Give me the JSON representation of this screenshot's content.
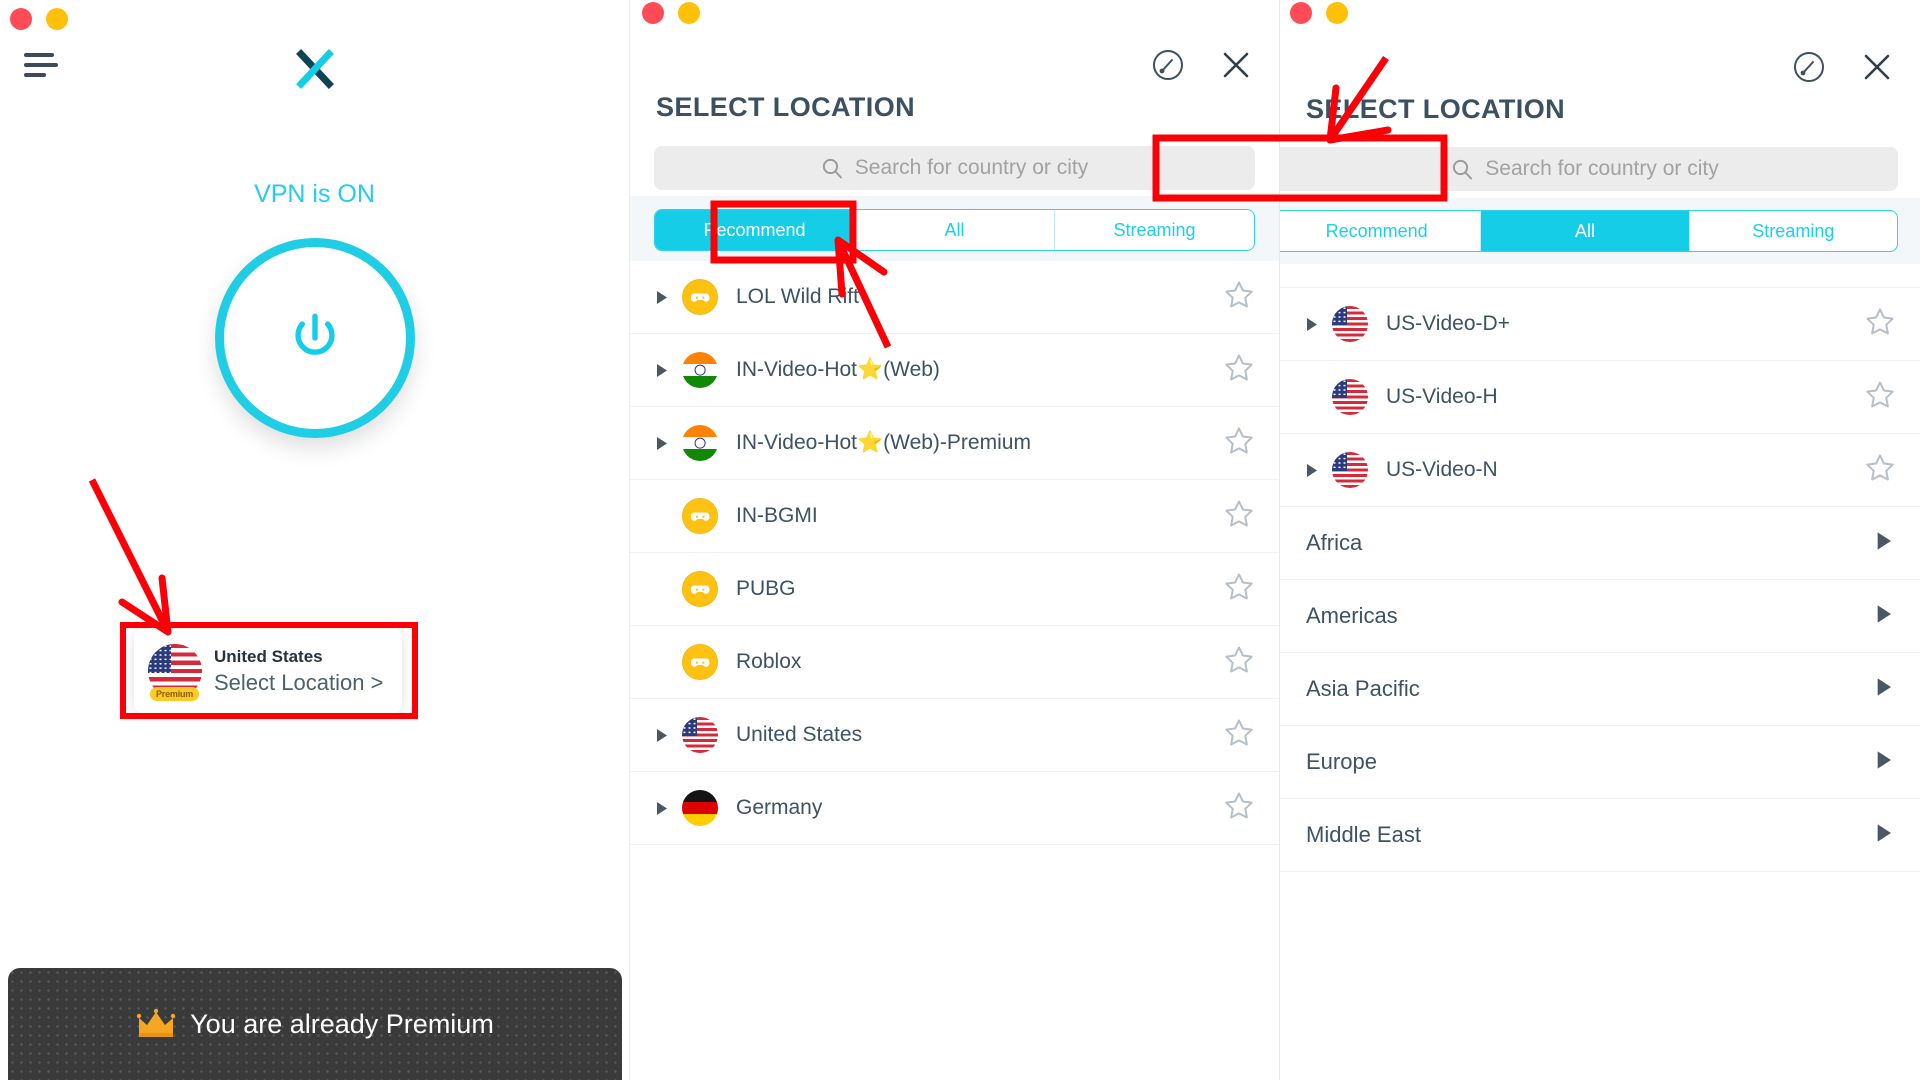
{
  "app": {
    "brand_logo": "x-logo",
    "menu_icon": "hamburger-icon"
  },
  "main_panel": {
    "vpn_status": "VPN is ON",
    "power_button_icon": "power-icon",
    "location_card": {
      "country": "United States",
      "flag": "us-flag",
      "badge": "Premium",
      "action": "Select Location >"
    },
    "premium_banner": {
      "icon": "crown-icon",
      "text": "You are already Premium"
    }
  },
  "middle_panel": {
    "title": "SELECT LOCATION",
    "speed_test_icon": "speedometer-icon",
    "close_icon": "close-icon",
    "search": {
      "icon": "search-icon",
      "placeholder": "Search for country or city",
      "value": ""
    },
    "tabs": [
      {
        "label": "Recommend",
        "active": true
      },
      {
        "label": "All",
        "active": false
      },
      {
        "label": "Streaming",
        "active": false
      }
    ],
    "rows": [
      {
        "label": "LOL Wild Rift",
        "flag": "game-icon",
        "expandable": true,
        "star": "star-outline-icon"
      },
      {
        "label": "IN-Video-Hot⭐(Web)",
        "flag": "in-flag",
        "expandable": true,
        "star": "star-outline-icon"
      },
      {
        "label": "IN-Video-Hot⭐(Web)-Premium",
        "flag": "in-flag",
        "expandable": true,
        "star": "star-outline-icon"
      },
      {
        "label": "IN-BGMI",
        "flag": "game-icon",
        "expandable": false,
        "star": "star-outline-icon"
      },
      {
        "label": "PUBG",
        "flag": "game-icon",
        "expandable": false,
        "star": "star-outline-icon"
      },
      {
        "label": "Roblox",
        "flag": "game-icon",
        "expandable": false,
        "star": "star-outline-icon"
      },
      {
        "label": "United States",
        "flag": "us-flag",
        "expandable": true,
        "star": "star-outline-icon"
      },
      {
        "label": "Germany",
        "flag": "de-flag",
        "expandable": true,
        "star": "star-outline-icon"
      }
    ]
  },
  "right_panel": {
    "title": "SELECT LOCATION",
    "speed_test_icon": "speedometer-icon",
    "close_icon": "close-icon",
    "search": {
      "icon": "search-icon",
      "placeholder": "Search for country or city",
      "value": ""
    },
    "tabs": [
      {
        "label": "Recommend",
        "active": false
      },
      {
        "label": "All",
        "active": true
      },
      {
        "label": "Streaming",
        "active": false
      }
    ],
    "rows": [
      {
        "label": "US-Video-D+",
        "flag": "us-flag",
        "expandable": true,
        "star": "star-outline-icon",
        "type": "server"
      },
      {
        "label": "US-Video-H",
        "flag": "us-flag",
        "expandable": false,
        "star": "star-outline-icon",
        "type": "server"
      },
      {
        "label": "US-Video-N",
        "flag": "us-flag",
        "expandable": true,
        "star": "star-outline-icon",
        "type": "server"
      }
    ],
    "regions": [
      {
        "label": "Africa",
        "chevron": "chevron-right-icon"
      },
      {
        "label": "Americas",
        "chevron": "chevron-right-icon"
      },
      {
        "label": "Asia Pacific",
        "chevron": "chevron-right-icon"
      },
      {
        "label": "Europe",
        "chevron": "chevron-right-icon"
      },
      {
        "label": "Middle East",
        "chevron": "chevron-right-icon"
      }
    ]
  },
  "annotations": {
    "accent_color": "#fb0007",
    "marks": [
      {
        "name": "arrow-to-location-card",
        "type": "arrow"
      },
      {
        "name": "box-around-location-card",
        "type": "box"
      },
      {
        "name": "box-around-all-tab",
        "type": "box"
      },
      {
        "name": "arrow-to-all-tab",
        "type": "arrow"
      },
      {
        "name": "box-around-search-field",
        "type": "box"
      },
      {
        "name": "arrow-to-search-field",
        "type": "arrow"
      }
    ]
  },
  "theme": {
    "cyan": "#16cde8",
    "title_color": "#3c5062",
    "premium_gold": "#ffc928"
  }
}
